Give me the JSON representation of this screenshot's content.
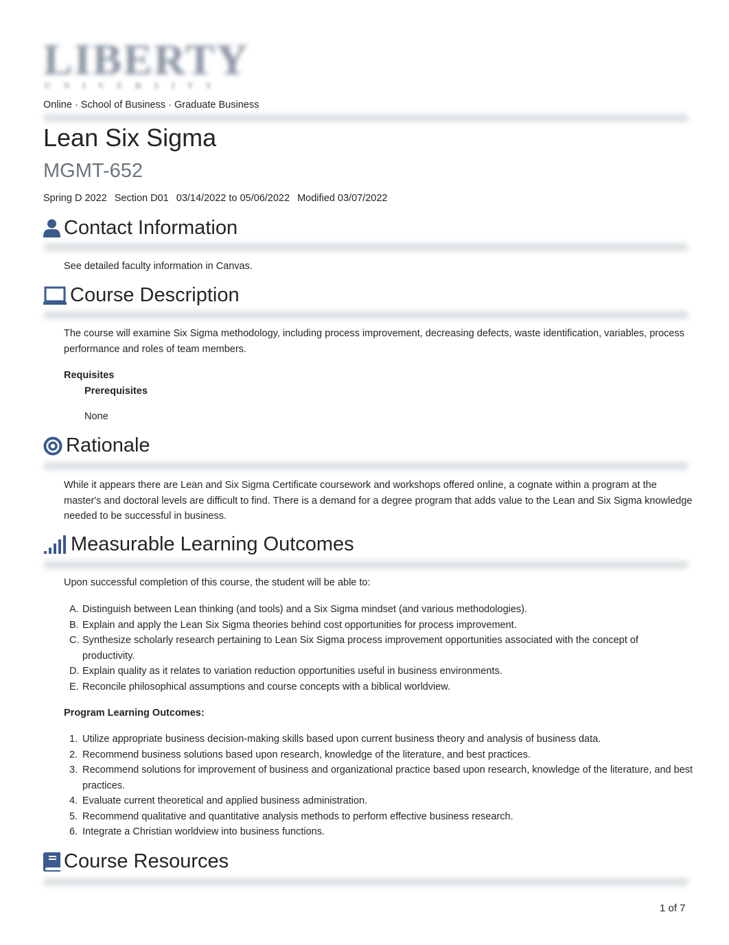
{
  "logo": {
    "main": "LIBERTY",
    "sub": "UNIVERSITY"
  },
  "breadcrumb": "Online · School of Business · Graduate Business",
  "course": {
    "title": "Lean Six Sigma",
    "code": "MGMT-652",
    "term": "Spring D 2022",
    "section": "Section D01",
    "dates": "03/14/2022 to 05/06/2022",
    "modified": "Modified 03/07/2022"
  },
  "sections": {
    "contact": {
      "icon": "user-icon",
      "heading": "Contact Information",
      "text": "See detailed faculty information in Canvas."
    },
    "description": {
      "icon": "laptop-icon",
      "heading": "Course Description",
      "text": "The course will examine Six Sigma methodology, including process improvement, decreasing defects, waste identification, variables, process performance and roles of team members.",
      "requisites_label": "Requisites",
      "prerequisites_label": "Prerequisites",
      "prerequisites_value": "None"
    },
    "rationale": {
      "icon": "bullseye-icon",
      "heading": "Rationale",
      "text": "While it appears there are Lean and Six Sigma Certificate coursework and workshops offered online, a cognate within a program at the master's and doctoral levels are difficult to find. There is a demand for a degree program that adds value to the Lean and Six Sigma knowledge needed to be successful in business."
    },
    "outcomes": {
      "icon": "signal-bars-icon",
      "heading": "Measurable Learning Outcomes",
      "intro": "Upon successful completion of this course, the student will be able to:",
      "items": [
        {
          "marker": "A.",
          "text": "Distinguish between Lean thinking (and tools) and a Six Sigma mindset (and various methodologies)."
        },
        {
          "marker": "B.",
          "text": "Explain and apply the Lean Six Sigma theories behind cost opportunities for process improvement."
        },
        {
          "marker": "C.",
          "text": "Synthesize scholarly research pertaining to Lean Six Sigma process improvement opportunities associated with the concept of productivity."
        },
        {
          "marker": "D.",
          "text": "Explain quality as it relates to variation reduction opportunities useful in business environments."
        },
        {
          "marker": "E.",
          "text": "Reconcile philosophical assumptions and course concepts with a biblical worldview."
        }
      ],
      "program_label": "Program Learning Outcomes:",
      "program_items": [
        {
          "marker": "1.",
          "text": "Utilize appropriate business decision-making skills based upon current business theory and analysis of business data."
        },
        {
          "marker": "2.",
          "text": "Recommend business solutions based upon research, knowledge of the literature, and best practices."
        },
        {
          "marker": "3.",
          "text": "Recommend solutions for improvement of business and organizational practice based upon research, knowledge of the literature, and best practices."
        },
        {
          "marker": "4.",
          "text": "Evaluate current theoretical and applied business administration."
        },
        {
          "marker": "5.",
          "text": "Recommend qualitative and quantitative analysis methods to perform effective business research."
        },
        {
          "marker": "6.",
          "text": "Integrate a Christian worldview into business functions."
        }
      ]
    },
    "resources": {
      "icon": "book-icon",
      "heading": "Course Resources"
    }
  },
  "footer": {
    "page_indicator": "1 of 7"
  },
  "colors": {
    "icon": "#3b5a8d",
    "text": "#212529",
    "muted": "#6c757d",
    "divider": "#dde1e3"
  }
}
